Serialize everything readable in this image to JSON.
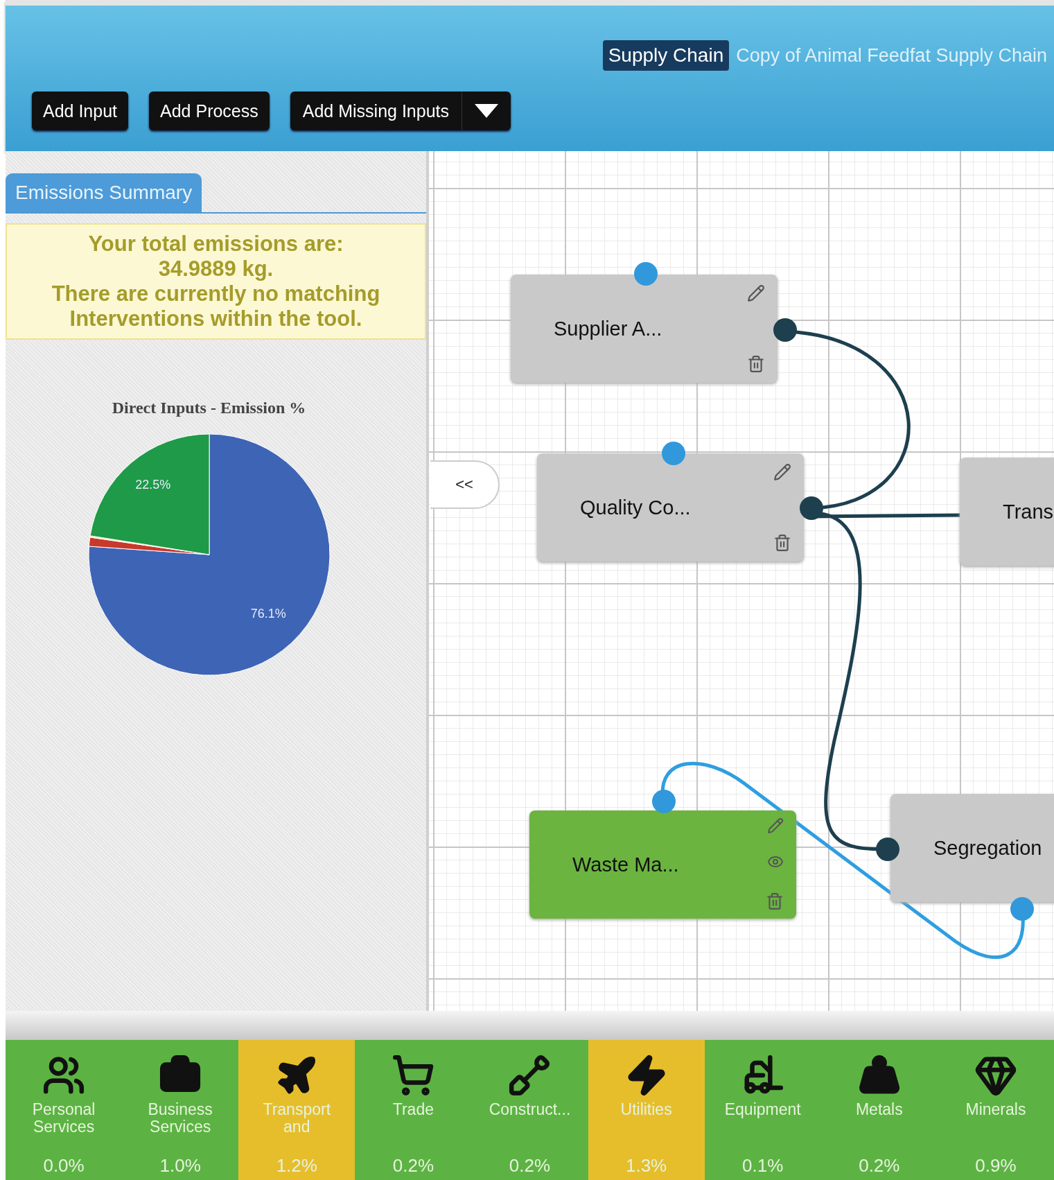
{
  "header": {
    "badge": "Supply Chain",
    "title": "Copy of Animal Feedfat Supply Chain"
  },
  "toolbar": {
    "buttons": [
      "Add Input",
      "Add Process"
    ],
    "split_button": "Add Missing Inputs"
  },
  "sidebar": {
    "tab": {
      "label": "Emissions Summary",
      "selected": true
    },
    "notice": [
      "Your total emissions are:",
      "34.9889 kg.",
      "There are currently no matching",
      "Interventions within the tool."
    ],
    "chart_data": {
      "type": "pie",
      "title": "Direct Inputs - Emission %",
      "values": [
        76.1,
        1.2,
        0.2,
        22.5
      ],
      "colors": [
        "#3e64b6",
        "#c8392b",
        "#f3e7a0",
        "#1e9a48"
      ],
      "value_labels": [
        "76.1%",
        null,
        null,
        "22.5%"
      ]
    }
  },
  "canvas": {
    "collapse_button": "<<",
    "nodes": [
      {
        "label": "Supplier A...",
        "kind": "process"
      },
      {
        "label": "Quality Co...",
        "kind": "process"
      },
      {
        "label": "Trans",
        "kind": "partial"
      },
      {
        "label": "Waste Ma...",
        "kind": "waste"
      },
      {
        "label": "Segregation",
        "kind": "partial"
      }
    ]
  },
  "categories": [
    {
      "label": "Personal Services",
      "value": "0.0%",
      "highlighted": false
    },
    {
      "label": "Business Services",
      "value": "1.0%",
      "highlighted": false
    },
    {
      "label": "Transport and",
      "value": "1.2%",
      "highlighted": true
    },
    {
      "label": "Trade",
      "value": "0.2%",
      "highlighted": false
    },
    {
      "label": "Construct...",
      "value": "0.2%",
      "highlighted": false
    },
    {
      "label": "Utilities",
      "value": "1.3%",
      "highlighted": true
    },
    {
      "label": "Equipment",
      "value": "0.1%",
      "highlighted": false
    },
    {
      "label": "Metals",
      "value": "0.2%",
      "highlighted": false
    },
    {
      "label": "Minerals",
      "value": "0.9%",
      "highlighted": false
    }
  ]
}
